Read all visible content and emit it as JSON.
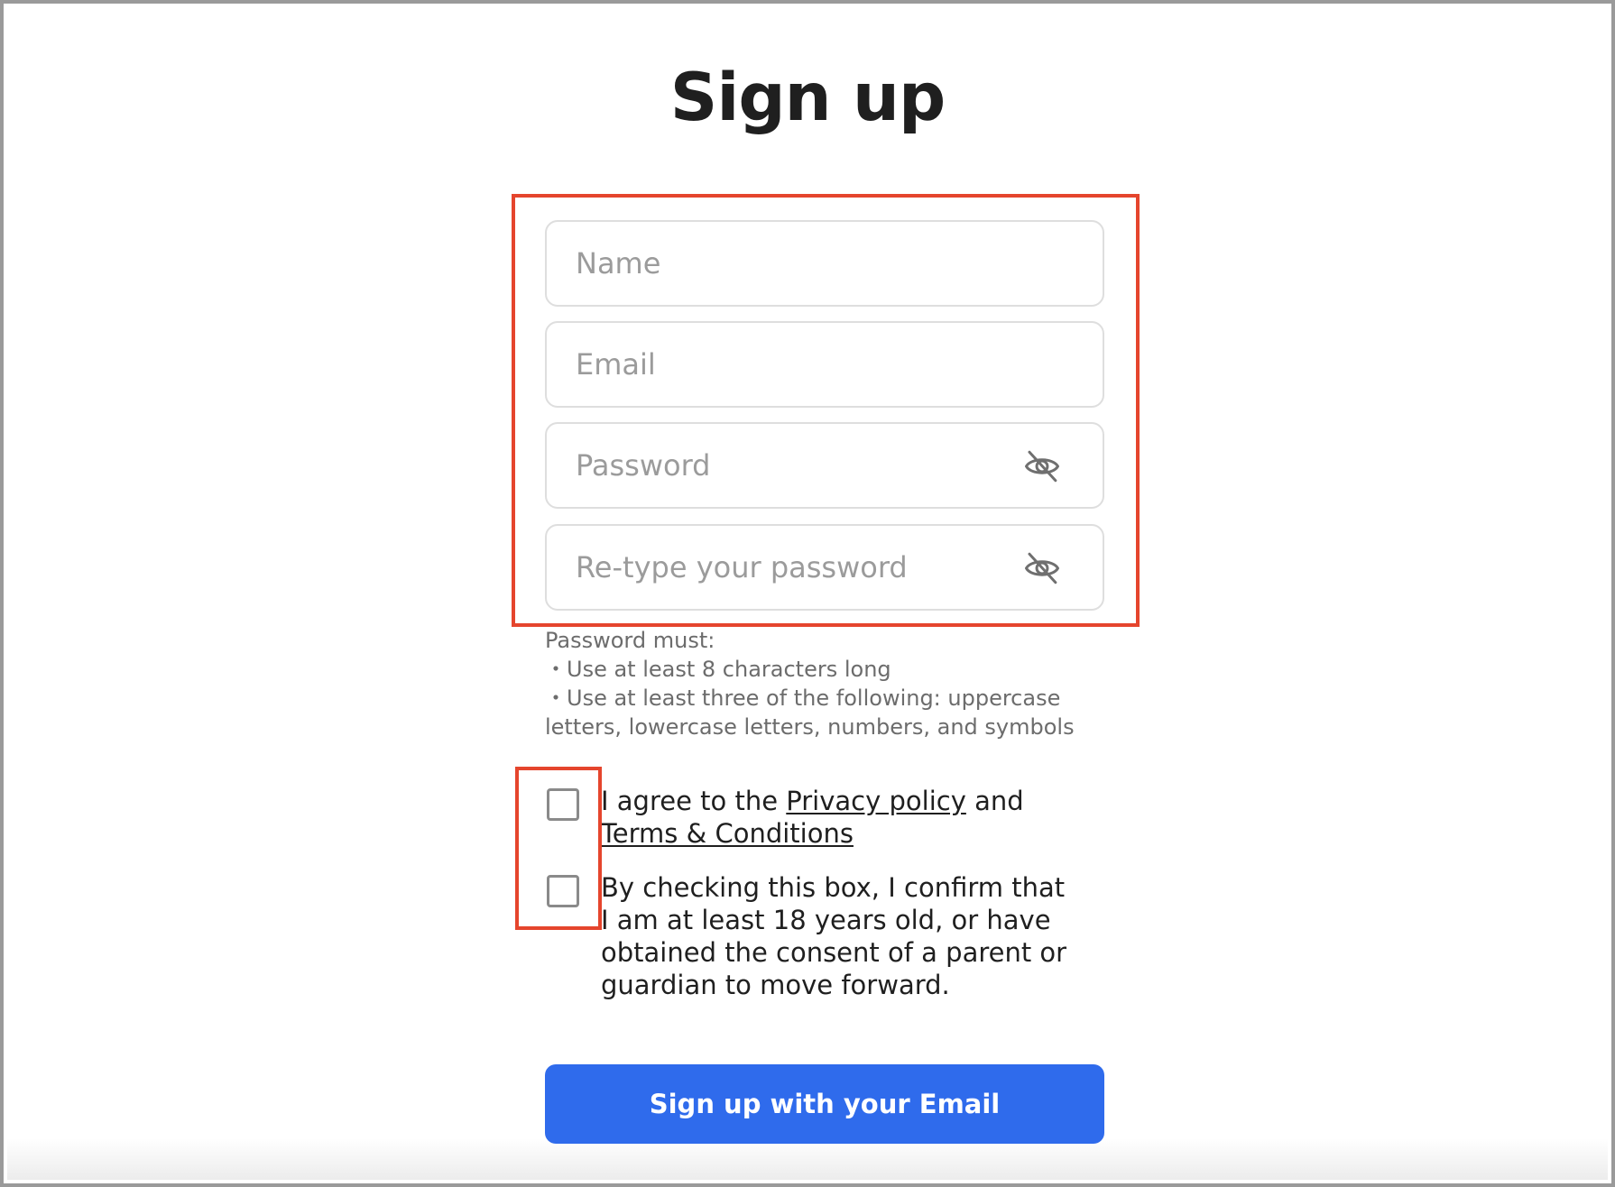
{
  "page": {
    "title": "Sign up"
  },
  "form": {
    "name": {
      "placeholder": "Name",
      "value": ""
    },
    "email": {
      "placeholder": "Email",
      "value": ""
    },
    "password": {
      "placeholder": "Password",
      "value": "",
      "toggle_icon": "eye-off-icon"
    },
    "password_confirm": {
      "placeholder": "Re-type your password",
      "value": "",
      "toggle_icon": "eye-off-icon"
    }
  },
  "password_rules": {
    "heading": "Password must:",
    "items": [
      "・Use at least 8 characters long",
      "・Use at least three of the following: uppercase letters, lowercase letters, numbers, and symbols"
    ]
  },
  "consents": {
    "terms": {
      "checked": false,
      "text_before": "I agree to the ",
      "privacy_link": "Privacy policy",
      "text_middle": " and ",
      "terms_link": "Terms & Conditions"
    },
    "age": {
      "checked": false,
      "text": "By checking this box, I confirm that I am at least 18 years old, or have obtained the consent of a parent or guardian to move forward."
    }
  },
  "submit": {
    "label": "Sign up with your Email"
  },
  "colors": {
    "primary": "#2f6bec",
    "highlight": "#e5452d",
    "title": "#1f1f1f",
    "muted": "#6c6c6c"
  }
}
